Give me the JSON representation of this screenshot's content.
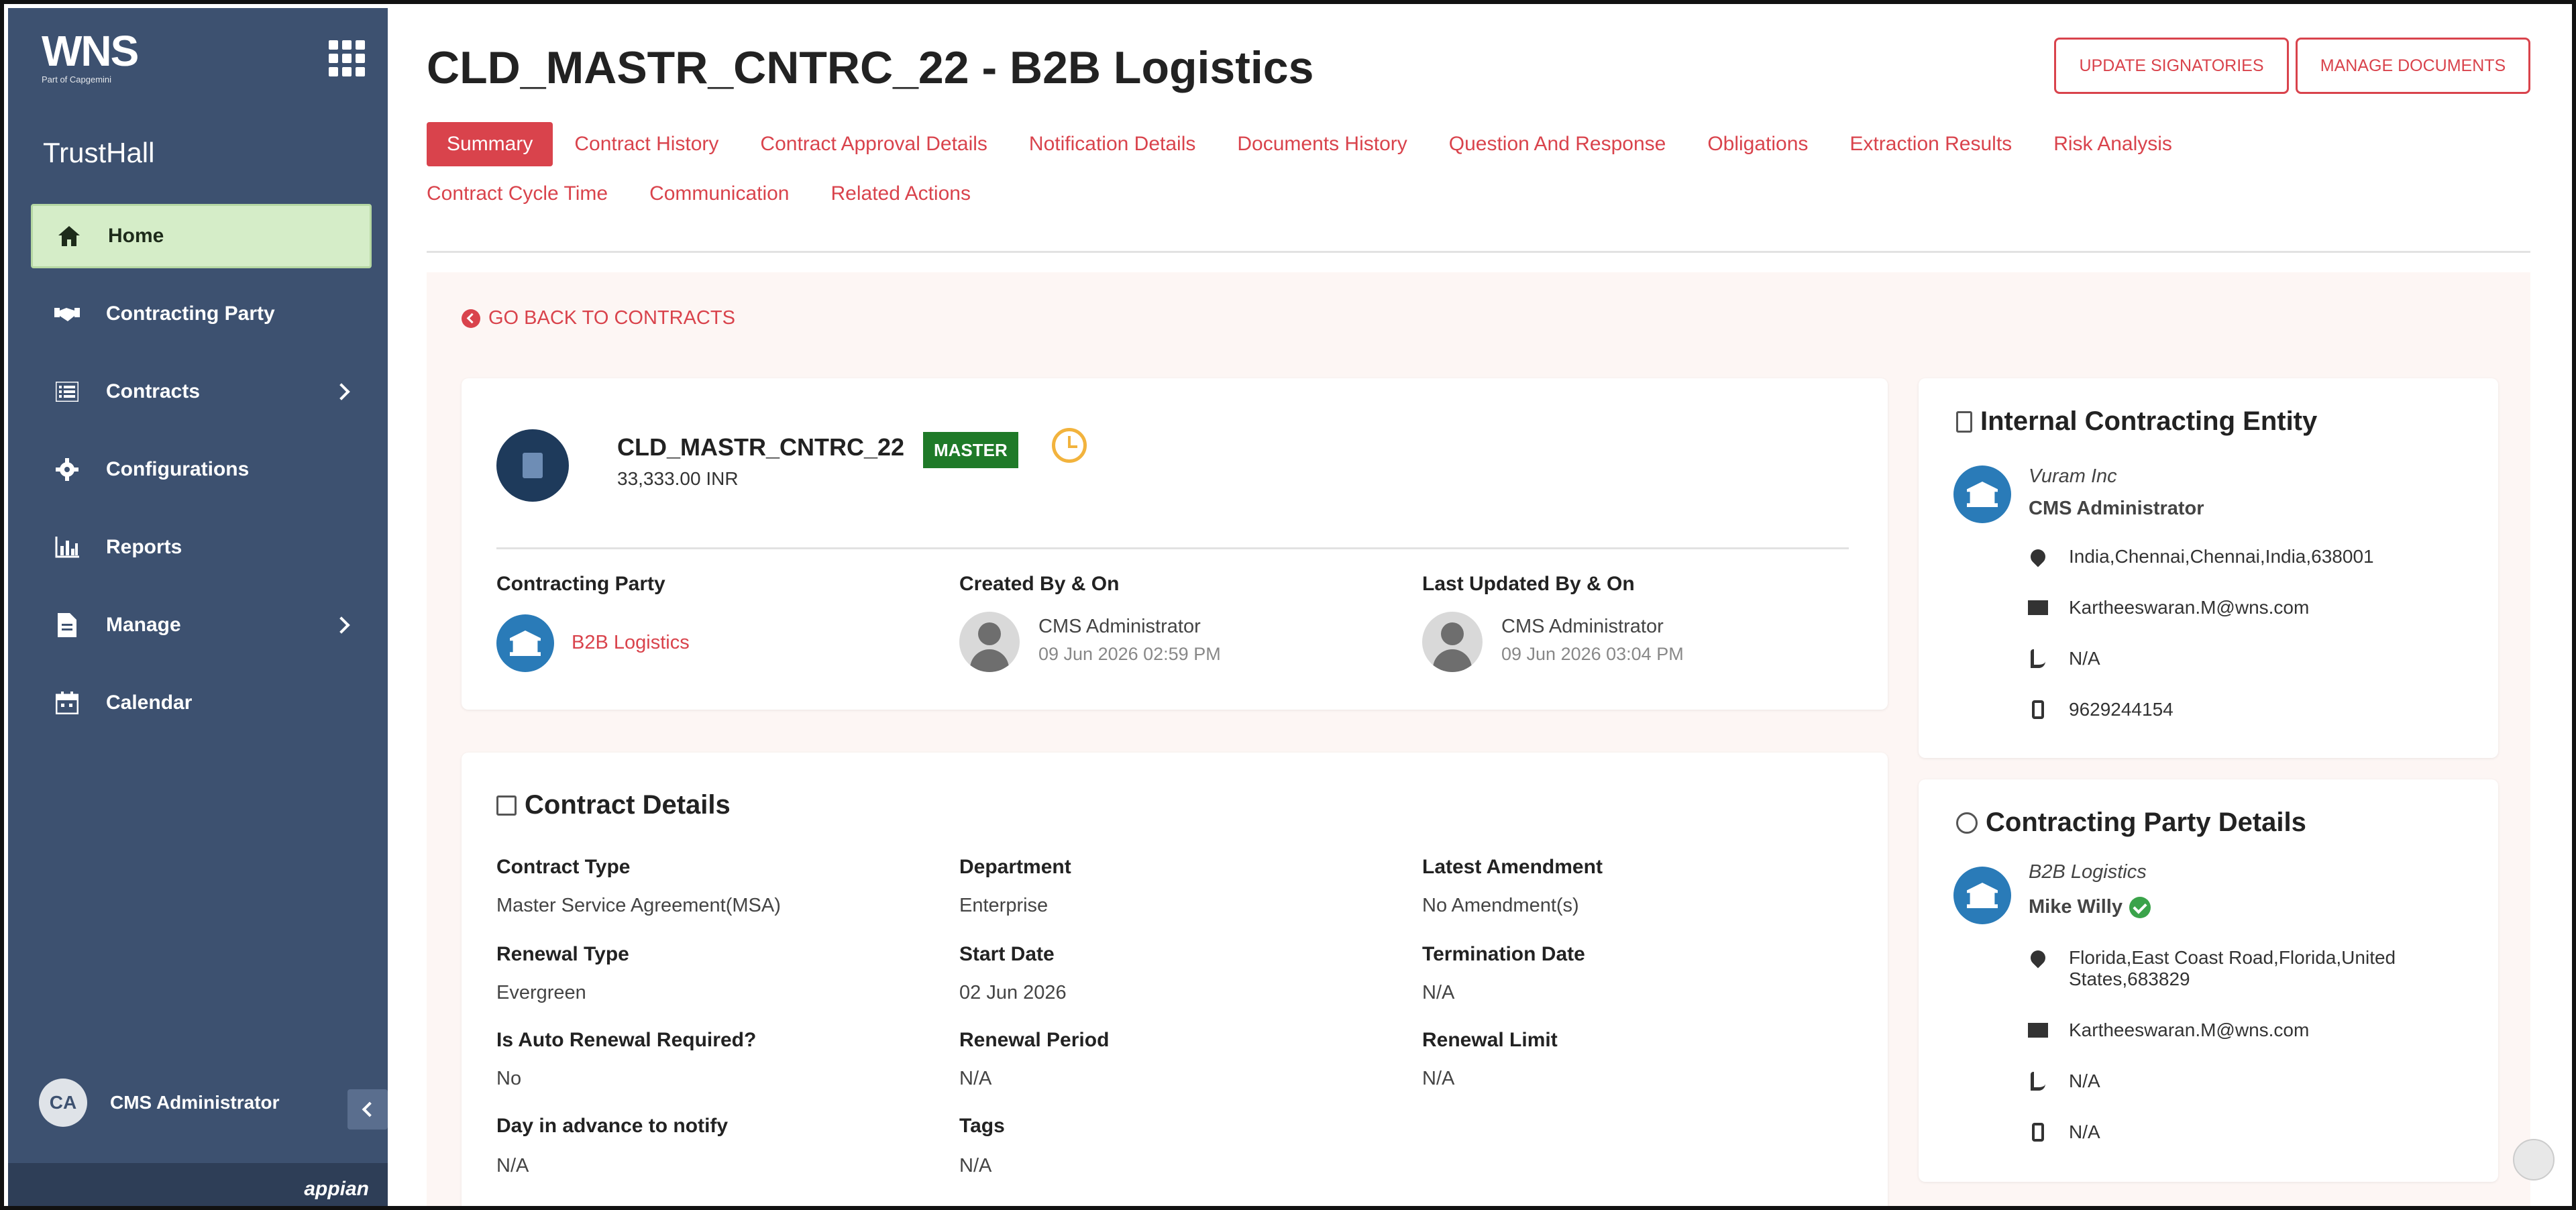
{
  "app": {
    "logo": "WNS",
    "logo_tagline": "Part of Capgemini",
    "brand": "TrustHall",
    "footer_brand": "appian"
  },
  "nav": {
    "home": "Home",
    "contracting_party": "Contracting Party",
    "contracts": "Contracts",
    "configurations": "Configurations",
    "reports": "Reports",
    "manage": "Manage",
    "calendar": "Calendar"
  },
  "user": {
    "initials": "CA",
    "name": "CMS Administrator"
  },
  "header": {
    "title": "CLD_MASTR_CNTRC_22 - B2B Logistics",
    "update_signatories": "UPDATE SIGNATORIES",
    "manage_documents": "MANAGE DOCUMENTS"
  },
  "tabs": {
    "summary": "Summary",
    "contract_history": "Contract History",
    "contract_approval_details": "Contract Approval Details",
    "notification_details": "Notification Details",
    "documents_history": "Documents History",
    "question_and_response": "Question And Response",
    "obligations": "Obligations",
    "extraction_results": "Extraction Results",
    "risk_analysis": "Risk Analysis",
    "contract_cycle_time": "Contract Cycle Time",
    "communication": "Communication",
    "related_actions": "Related Actions"
  },
  "goback": "GO BACK TO CONTRACTS",
  "contract": {
    "name": "CLD_MASTR_CNTRC_22",
    "badge": "MASTER",
    "amount": "33,333.00 INR",
    "contracting_party_label": "Contracting Party",
    "contracting_party": "B2B Logistics",
    "created_label": "Created By & On",
    "created_by": "CMS Administrator",
    "created_on": "09 Jun 2026 02:59 PM",
    "updated_label": "Last Updated By & On",
    "updated_by": "CMS Administrator",
    "updated_on": "09 Jun 2026 03:04 PM"
  },
  "details": {
    "title": "Contract Details",
    "contract_type_label": "Contract Type",
    "contract_type": "Master Service Agreement(MSA)",
    "department_label": "Department",
    "department": "Enterprise",
    "latest_amendment_label": "Latest Amendment",
    "latest_amendment": "No Amendment(s)",
    "renewal_type_label": "Renewal Type",
    "renewal_type": "Evergreen",
    "start_date_label": "Start Date",
    "start_date": "02 Jun 2026",
    "termination_date_label": "Termination Date",
    "termination_date": "N/A",
    "auto_renewal_label": "Is Auto Renewal Required?",
    "auto_renewal": "No",
    "renewal_period_label": "Renewal Period",
    "renewal_period": "N/A",
    "renewal_limit_label": "Renewal Limit",
    "renewal_limit": "N/A",
    "advance_notify_label": "Day in advance to notify",
    "advance_notify": "N/A",
    "tags_label": "Tags",
    "tags": "N/A"
  },
  "internal_entity": {
    "title": "Internal Contracting Entity",
    "company": "Vuram Inc",
    "contact": "CMS Administrator",
    "address": "India,Chennai,Chennai,India,638001",
    "email": "Kartheeswaran.M@wns.com",
    "phone": "N/A",
    "mobile": "9629244154"
  },
  "party_details": {
    "title": "Contracting Party Details",
    "company": "B2B Logistics",
    "contact": "Mike Willy",
    "address_line1": "Florida,East Coast Road,Florida,United",
    "address_line2": "States,683829",
    "email": "Kartheeswaran.M@wns.com",
    "phone": "N/A",
    "mobile": "N/A"
  }
}
